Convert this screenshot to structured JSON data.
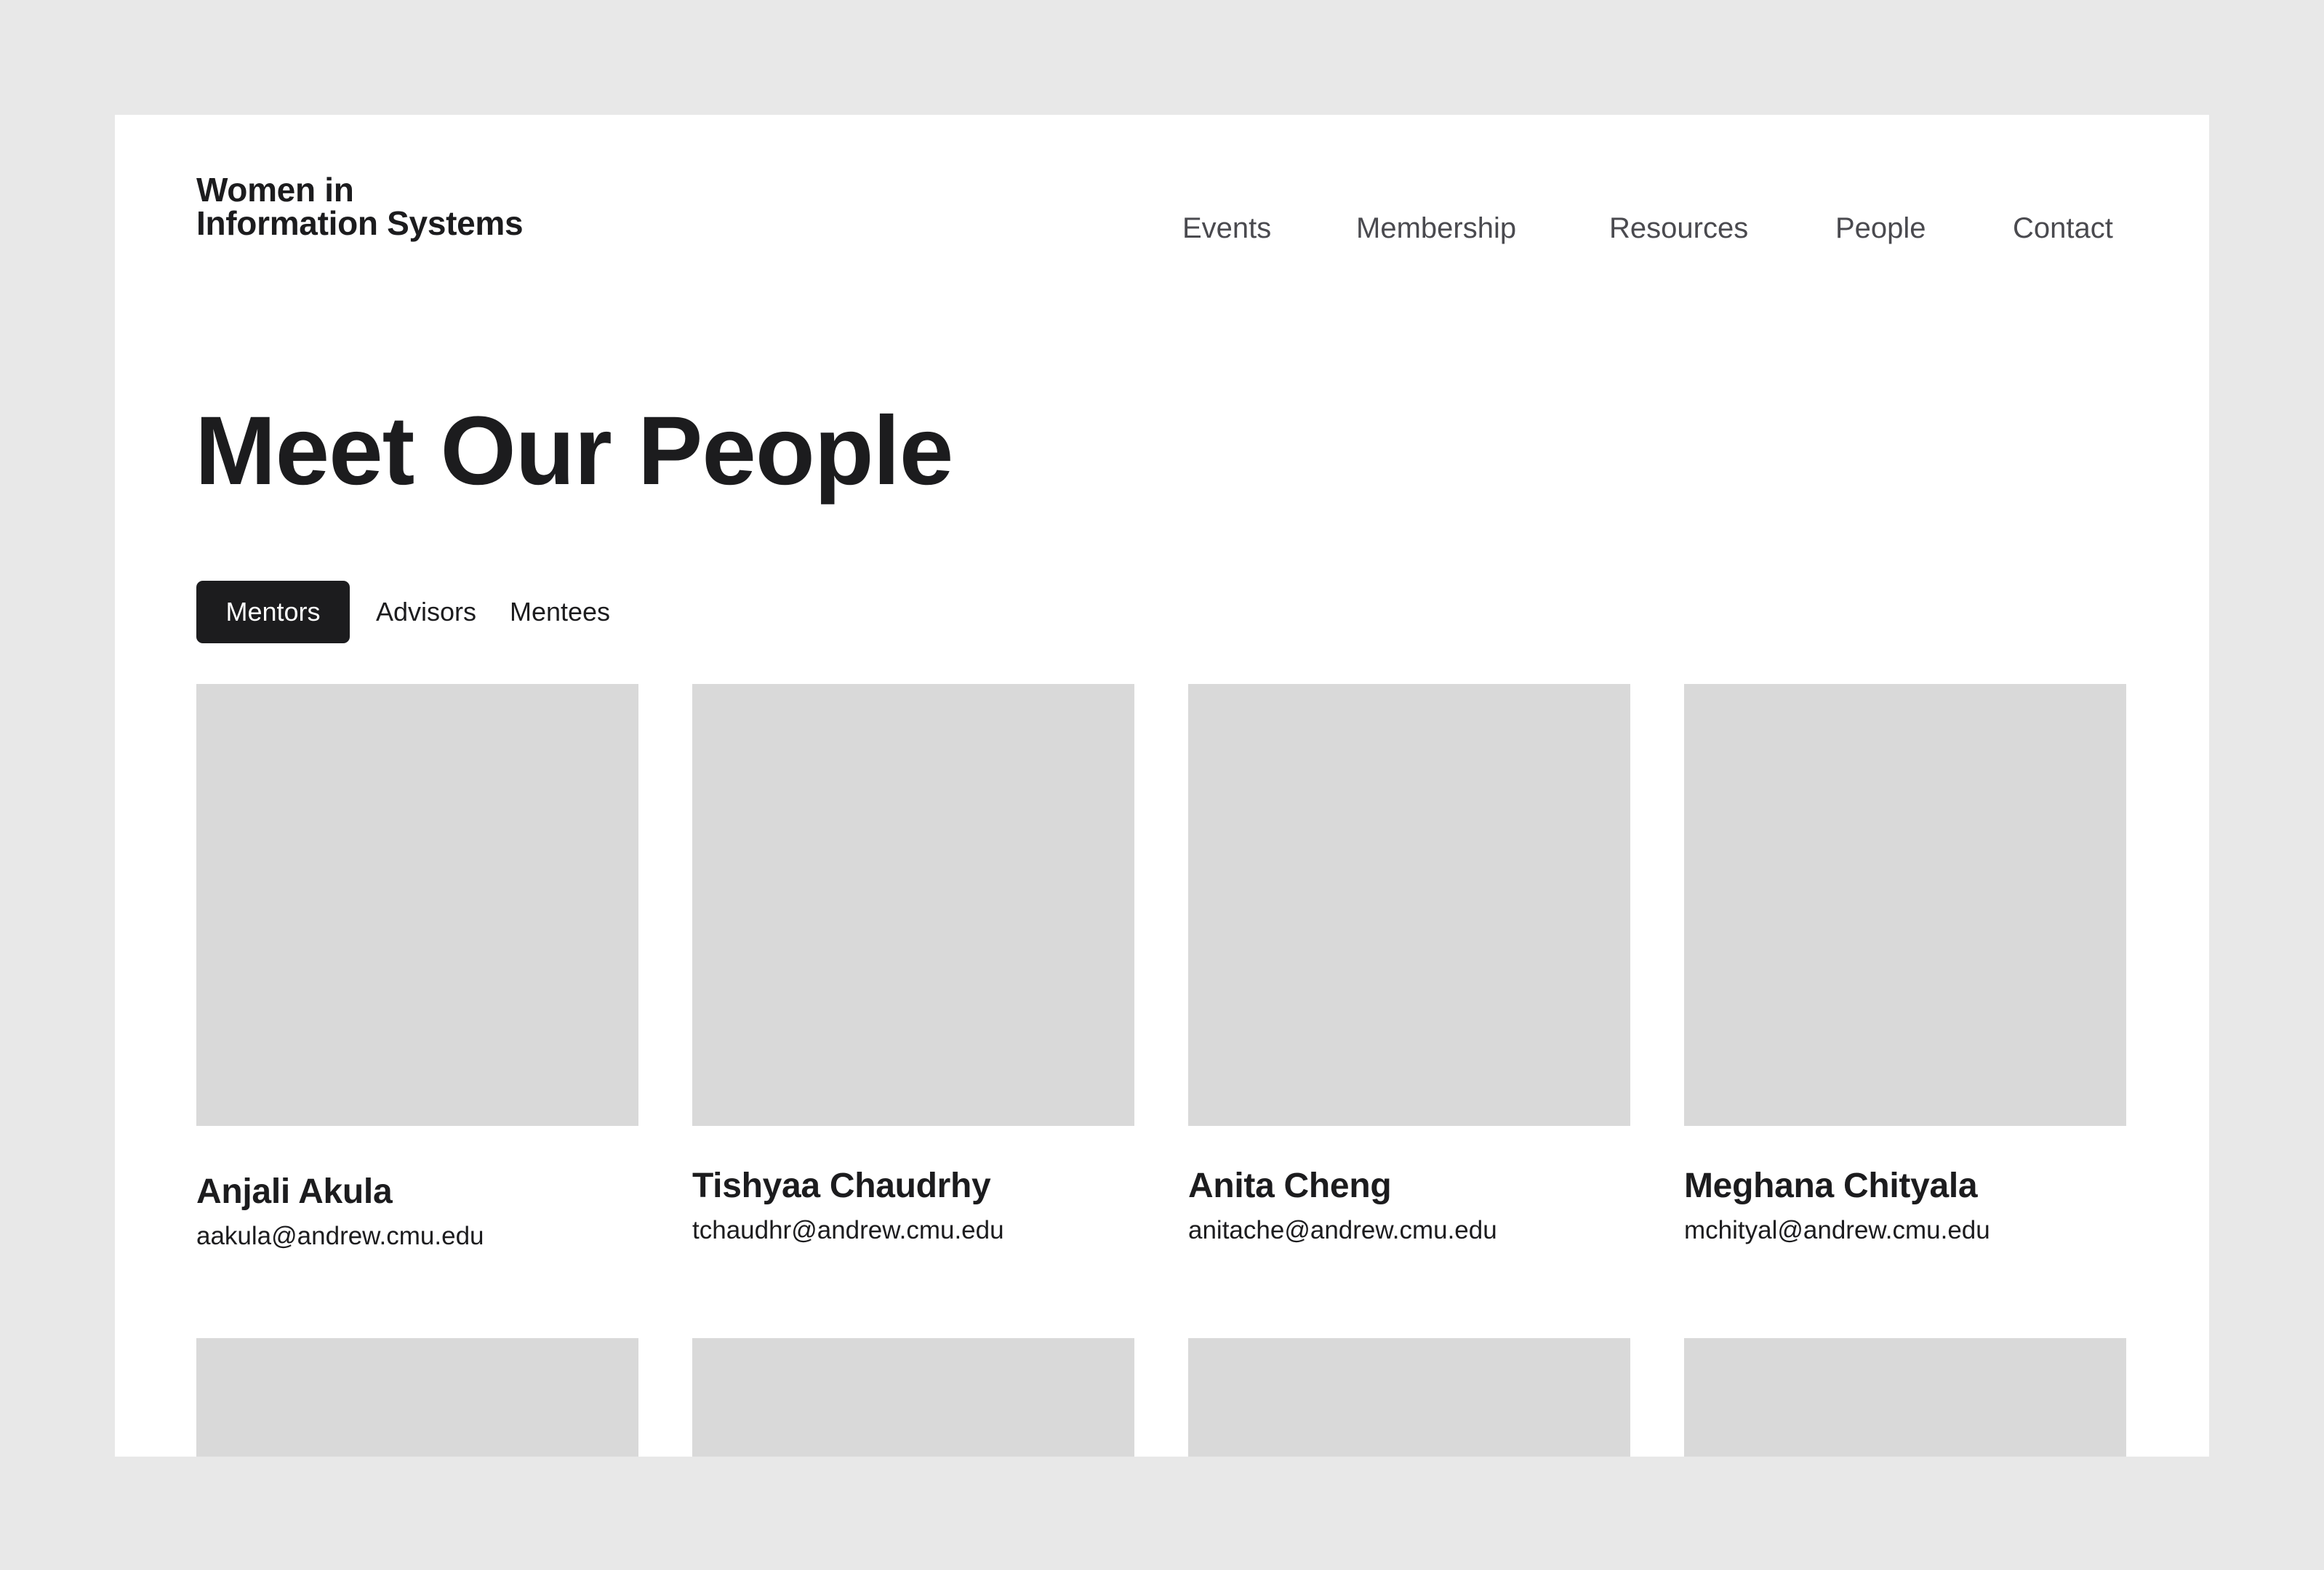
{
  "header": {
    "logo_line1": "Women in",
    "logo_line2": "Information Systems",
    "nav": [
      {
        "label": "Events"
      },
      {
        "label": "Membership"
      },
      {
        "label": "Resources"
      },
      {
        "label": "People"
      },
      {
        "label": "Contact"
      }
    ]
  },
  "main": {
    "title": "Meet Our People",
    "tabs": [
      {
        "label": "Mentors",
        "active": true
      },
      {
        "label": "Advisors",
        "active": false
      },
      {
        "label": "Mentees",
        "active": false
      }
    ],
    "people": [
      {
        "name": "Anjali Akula",
        "email": "aakula@andrew.cmu.edu"
      },
      {
        "name": "Tishyaa Chaudrhy",
        "email": "tchaudhr@andrew.cmu.edu"
      },
      {
        "name": "Anita Cheng",
        "email": "anitache@andrew.cmu.edu"
      },
      {
        "name": "Meghana Chityala",
        "email": "mchityal@andrew.cmu.edu"
      }
    ]
  },
  "colors": {
    "background": "#e8e8e8",
    "page": "#ffffff",
    "text": "#1c1c1e",
    "nav_text": "#4a4a4f",
    "placeholder": "#d9d9d9",
    "active_tab": "#1c1c1e"
  }
}
